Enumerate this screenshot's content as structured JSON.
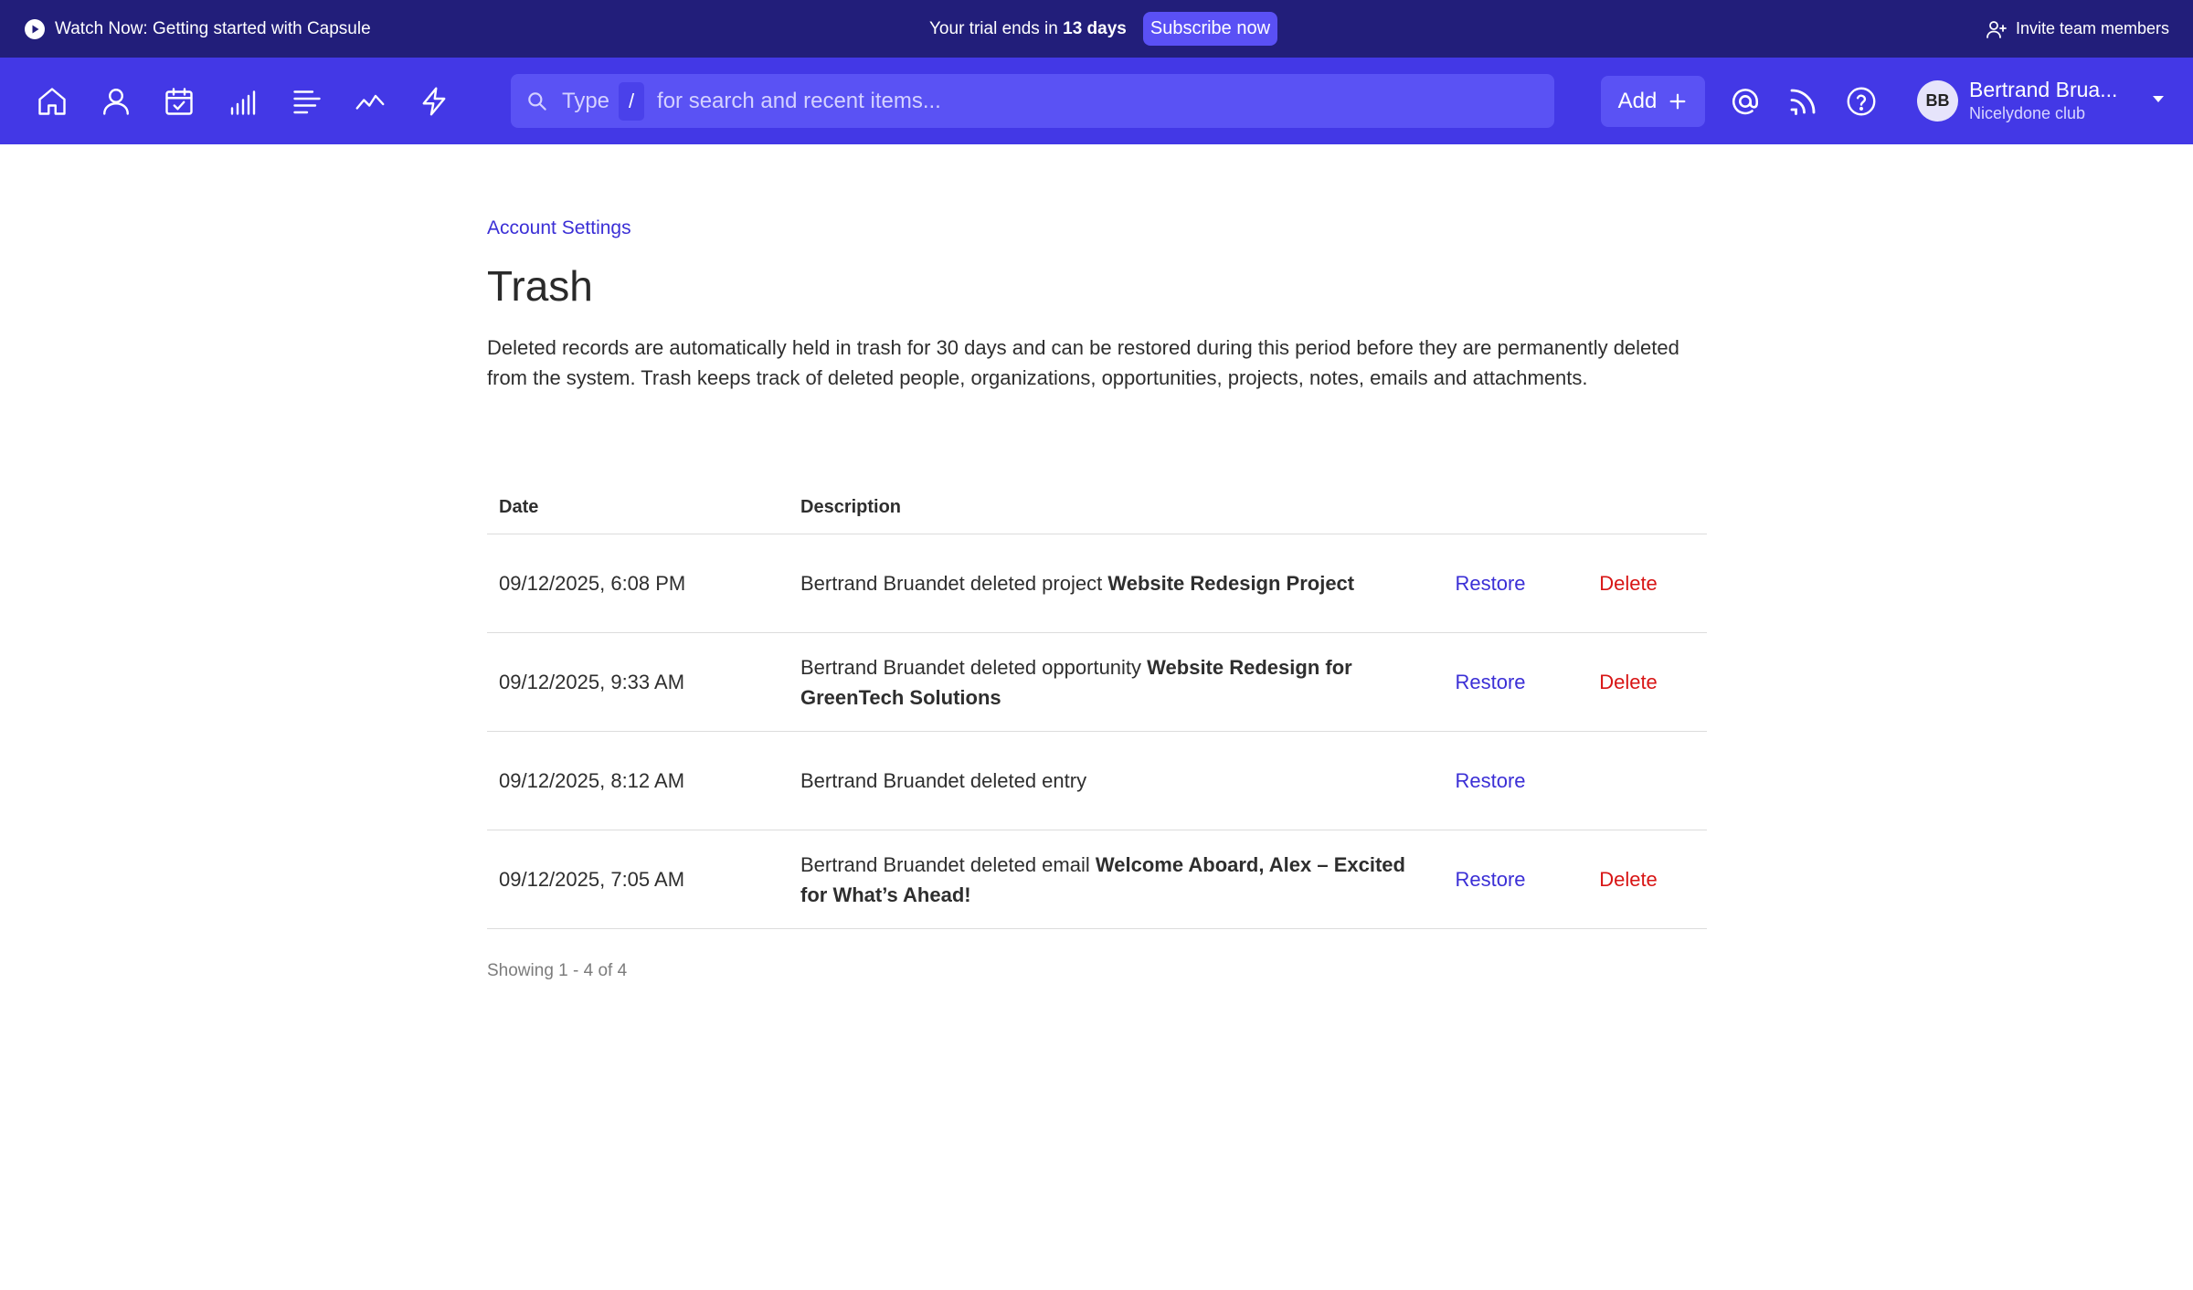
{
  "banner": {
    "watch_label": "Watch Now: Getting started with Capsule",
    "trial_prefix": "Your trial ends in",
    "trial_days": "13 days",
    "subscribe_label": "Subscribe now",
    "invite_label": "Invite team members"
  },
  "nav": {
    "icons": [
      "home-icon",
      "person-icon",
      "calendar-check-icon",
      "pipeline-bars-icon",
      "projects-lines-icon",
      "reports-trend-icon",
      "workflow-bolt-icon"
    ],
    "search": {
      "placeholder_start": "Type",
      "shortcut_key": "/",
      "placeholder_end": "for search and recent items..."
    },
    "add_label": "Add",
    "right_icons": [
      "at-mention-icon",
      "rss-feed-icon",
      "help-icon"
    ],
    "user": {
      "initials": "BB",
      "name": "Bertrand Brua...",
      "org": "Nicelydone club"
    }
  },
  "page": {
    "breadcrumb": "Account Settings",
    "title": "Trash",
    "description": "Deleted records are automatically held in trash for 30 days and can be restored during this period before they are permanently deleted from the system. Trash keeps track of deleted people, organizations, opportunities, projects, notes, emails and attachments."
  },
  "table": {
    "headers": {
      "date": "Date",
      "description": "Description"
    },
    "restore_label": "Restore",
    "delete_label": "Delete",
    "rows": [
      {
        "date": "09/12/2025, 6:08 PM",
        "text": "Bertrand Bruandet deleted project",
        "item": "Website Redesign Project",
        "can_delete": true
      },
      {
        "date": "09/12/2025, 9:33 AM",
        "text": "Bertrand Bruandet deleted opportunity",
        "item": "Website Redesign for GreenTech Solutions",
        "can_delete": true
      },
      {
        "date": "09/12/2025, 8:12 AM",
        "text": "Bertrand Bruandet deleted entry",
        "item": "",
        "can_delete": false
      },
      {
        "date": "09/12/2025, 7:05 AM",
        "text": "Bertrand Bruandet deleted email",
        "item": "Welcome Aboard, Alex – Excited for What’s Ahead!",
        "can_delete": true
      }
    ],
    "footer": "Showing 1 - 4 of 4"
  },
  "colors": {
    "banner_bg": "#221e7a",
    "nav_bg": "#4338e6",
    "link": "#3b2fd6",
    "danger": "#d81515"
  }
}
